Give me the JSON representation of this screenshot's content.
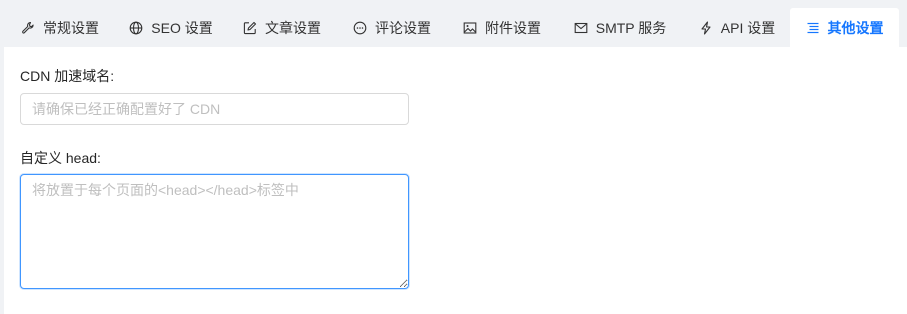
{
  "tabs": [
    {
      "label": "常规设置",
      "icon": "wrench-icon"
    },
    {
      "label": "SEO 设置",
      "icon": "globe-icon"
    },
    {
      "label": "文章设置",
      "icon": "edit-icon"
    },
    {
      "label": "评论设置",
      "icon": "comment-icon"
    },
    {
      "label": "附件设置",
      "icon": "image-icon"
    },
    {
      "label": "SMTP 服务",
      "icon": "mail-icon"
    },
    {
      "label": "API 设置",
      "icon": "thunderbolt-icon"
    },
    {
      "label": "其他设置",
      "icon": "align-left-icon",
      "active": true
    }
  ],
  "form": {
    "cdn_label": "CDN 加速域名:",
    "cdn_placeholder": "请确保已经正确配置好了 CDN",
    "cdn_value": "",
    "head_label": "自定义 head:",
    "head_placeholder": "将放置于每个页面的<head></head>标签中",
    "head_value": ""
  },
  "colors": {
    "accent": "#1677ff",
    "tabbar_bg": "#f0f2f5",
    "focus_border": "#4096ff"
  }
}
